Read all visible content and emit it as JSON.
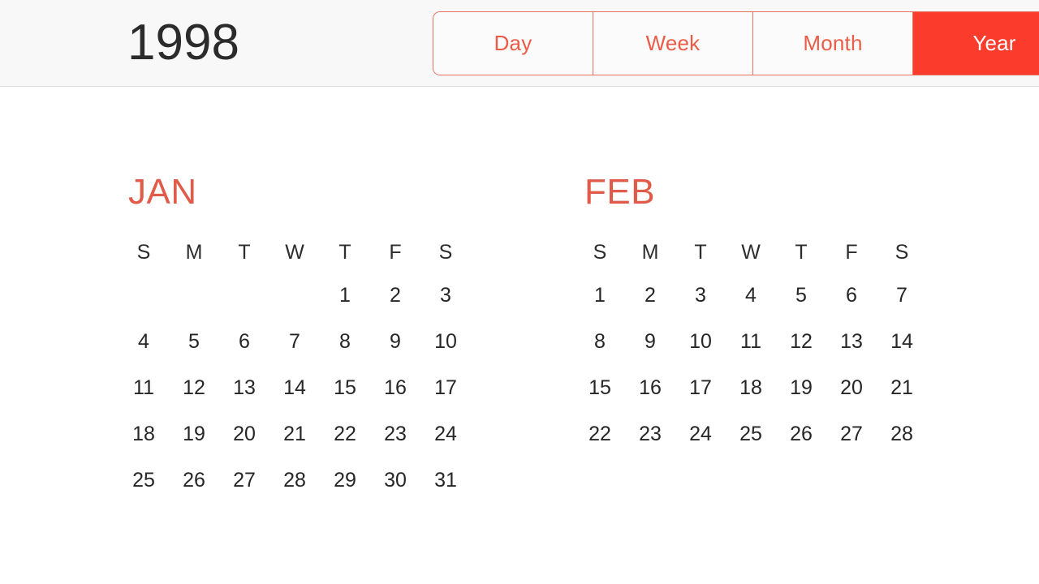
{
  "header": {
    "year_label": "1998",
    "accent_selected_color": "#fb3b2b",
    "accent_border_color": "#e8705f",
    "accent_text_color": "#ea5c48",
    "background_color": "#f8f8f8"
  },
  "view_switcher": {
    "selected": "Year",
    "segments": [
      {
        "label": "Day",
        "selected": false
      },
      {
        "label": "Week",
        "selected": false
      },
      {
        "label": "Month",
        "selected": false
      },
      {
        "label": "Year",
        "selected": true
      }
    ]
  },
  "calendar": {
    "year": "1998",
    "weekday_headers": [
      "S",
      "M",
      "T",
      "W",
      "T",
      "F",
      "S"
    ],
    "month_name_color": "#e05b49",
    "months": [
      {
        "name": "JAN",
        "full_name": "January",
        "start_weekday_index": 4,
        "num_days": 31,
        "weeks": [
          [
            "",
            "",
            "",
            "",
            "1",
            "2",
            "3"
          ],
          [
            "4",
            "5",
            "6",
            "7",
            "8",
            "9",
            "10"
          ],
          [
            "11",
            "12",
            "13",
            "14",
            "15",
            "16",
            "17"
          ],
          [
            "18",
            "19",
            "20",
            "21",
            "22",
            "23",
            "24"
          ],
          [
            "25",
            "26",
            "27",
            "28",
            "29",
            "30",
            "31"
          ]
        ]
      },
      {
        "name": "FEB",
        "full_name": "February",
        "start_weekday_index": 0,
        "num_days": 28,
        "weeks": [
          [
            "1",
            "2",
            "3",
            "4",
            "5",
            "6",
            "7"
          ],
          [
            "8",
            "9",
            "10",
            "11",
            "12",
            "13",
            "14"
          ],
          [
            "15",
            "16",
            "17",
            "18",
            "19",
            "20",
            "21"
          ],
          [
            "22",
            "23",
            "24",
            "25",
            "26",
            "27",
            "28"
          ]
        ]
      }
    ]
  }
}
